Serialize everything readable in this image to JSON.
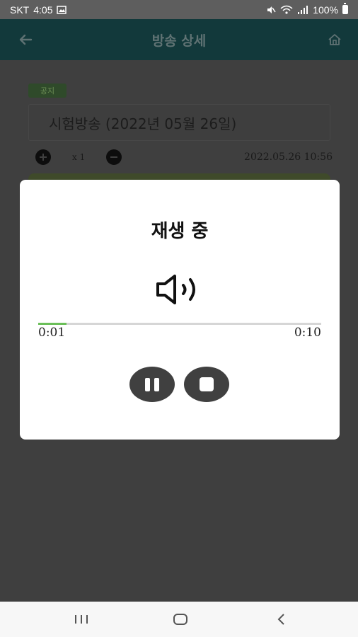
{
  "status_bar": {
    "carrier": "SKT",
    "time": "4:05",
    "battery": "100%"
  },
  "app_bar": {
    "title": "방송 상세"
  },
  "background": {
    "tag_label": "공지",
    "broadcast_title": "시험방송 (2022년 05월 26일)",
    "zoom_level": "x 1",
    "datetime": "2022.05.26 10:56"
  },
  "dialog": {
    "title": "재생 중",
    "elapsed": "0:01",
    "total": "0:10",
    "progress": 0.1
  },
  "colors": {
    "app_bar_bg": "#12393b",
    "progress_fill": "#6bbf59",
    "control_button": "#404040"
  },
  "icons": {
    "back": "arrow-left",
    "home": "house-outline",
    "speaker": "volume-up",
    "pause": "pause",
    "stop": "stop"
  }
}
